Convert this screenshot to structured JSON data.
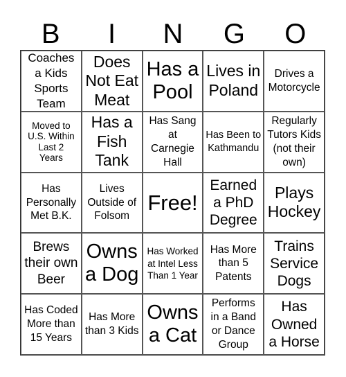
{
  "title_letters": [
    "B",
    "I",
    "N",
    "G",
    "O"
  ],
  "cells": [
    [
      "Coaches a Kids Sports Team",
      "Does Not Eat Meat",
      "Has a Pool",
      "Lives in Poland",
      "Drives a Motorcycle"
    ],
    [
      "Moved to U.S. Within Last 2 Years",
      "Has a Fish Tank",
      "Has Sang at Carnegie Hall",
      "Has Been to Kathmandu",
      "Regularly Tutors Kids (not their own)"
    ],
    [
      "Has Personally Met B.K.",
      "Lives Outside of Folsom",
      "Free!",
      "Earned a PhD Degree",
      "Plays Hockey"
    ],
    [
      "Brews their own Beer",
      "Owns a Dog",
      "Has Worked at Intel Less Than 1 Year",
      "Has More than 5 Patents",
      "Trains Service Dogs"
    ],
    [
      "Has Coded More than 15 Years",
      "Has More than 3 Kids",
      "Owns a Cat",
      "Performs in a Band or Dance Group",
      "Has Owned a Horse"
    ]
  ]
}
